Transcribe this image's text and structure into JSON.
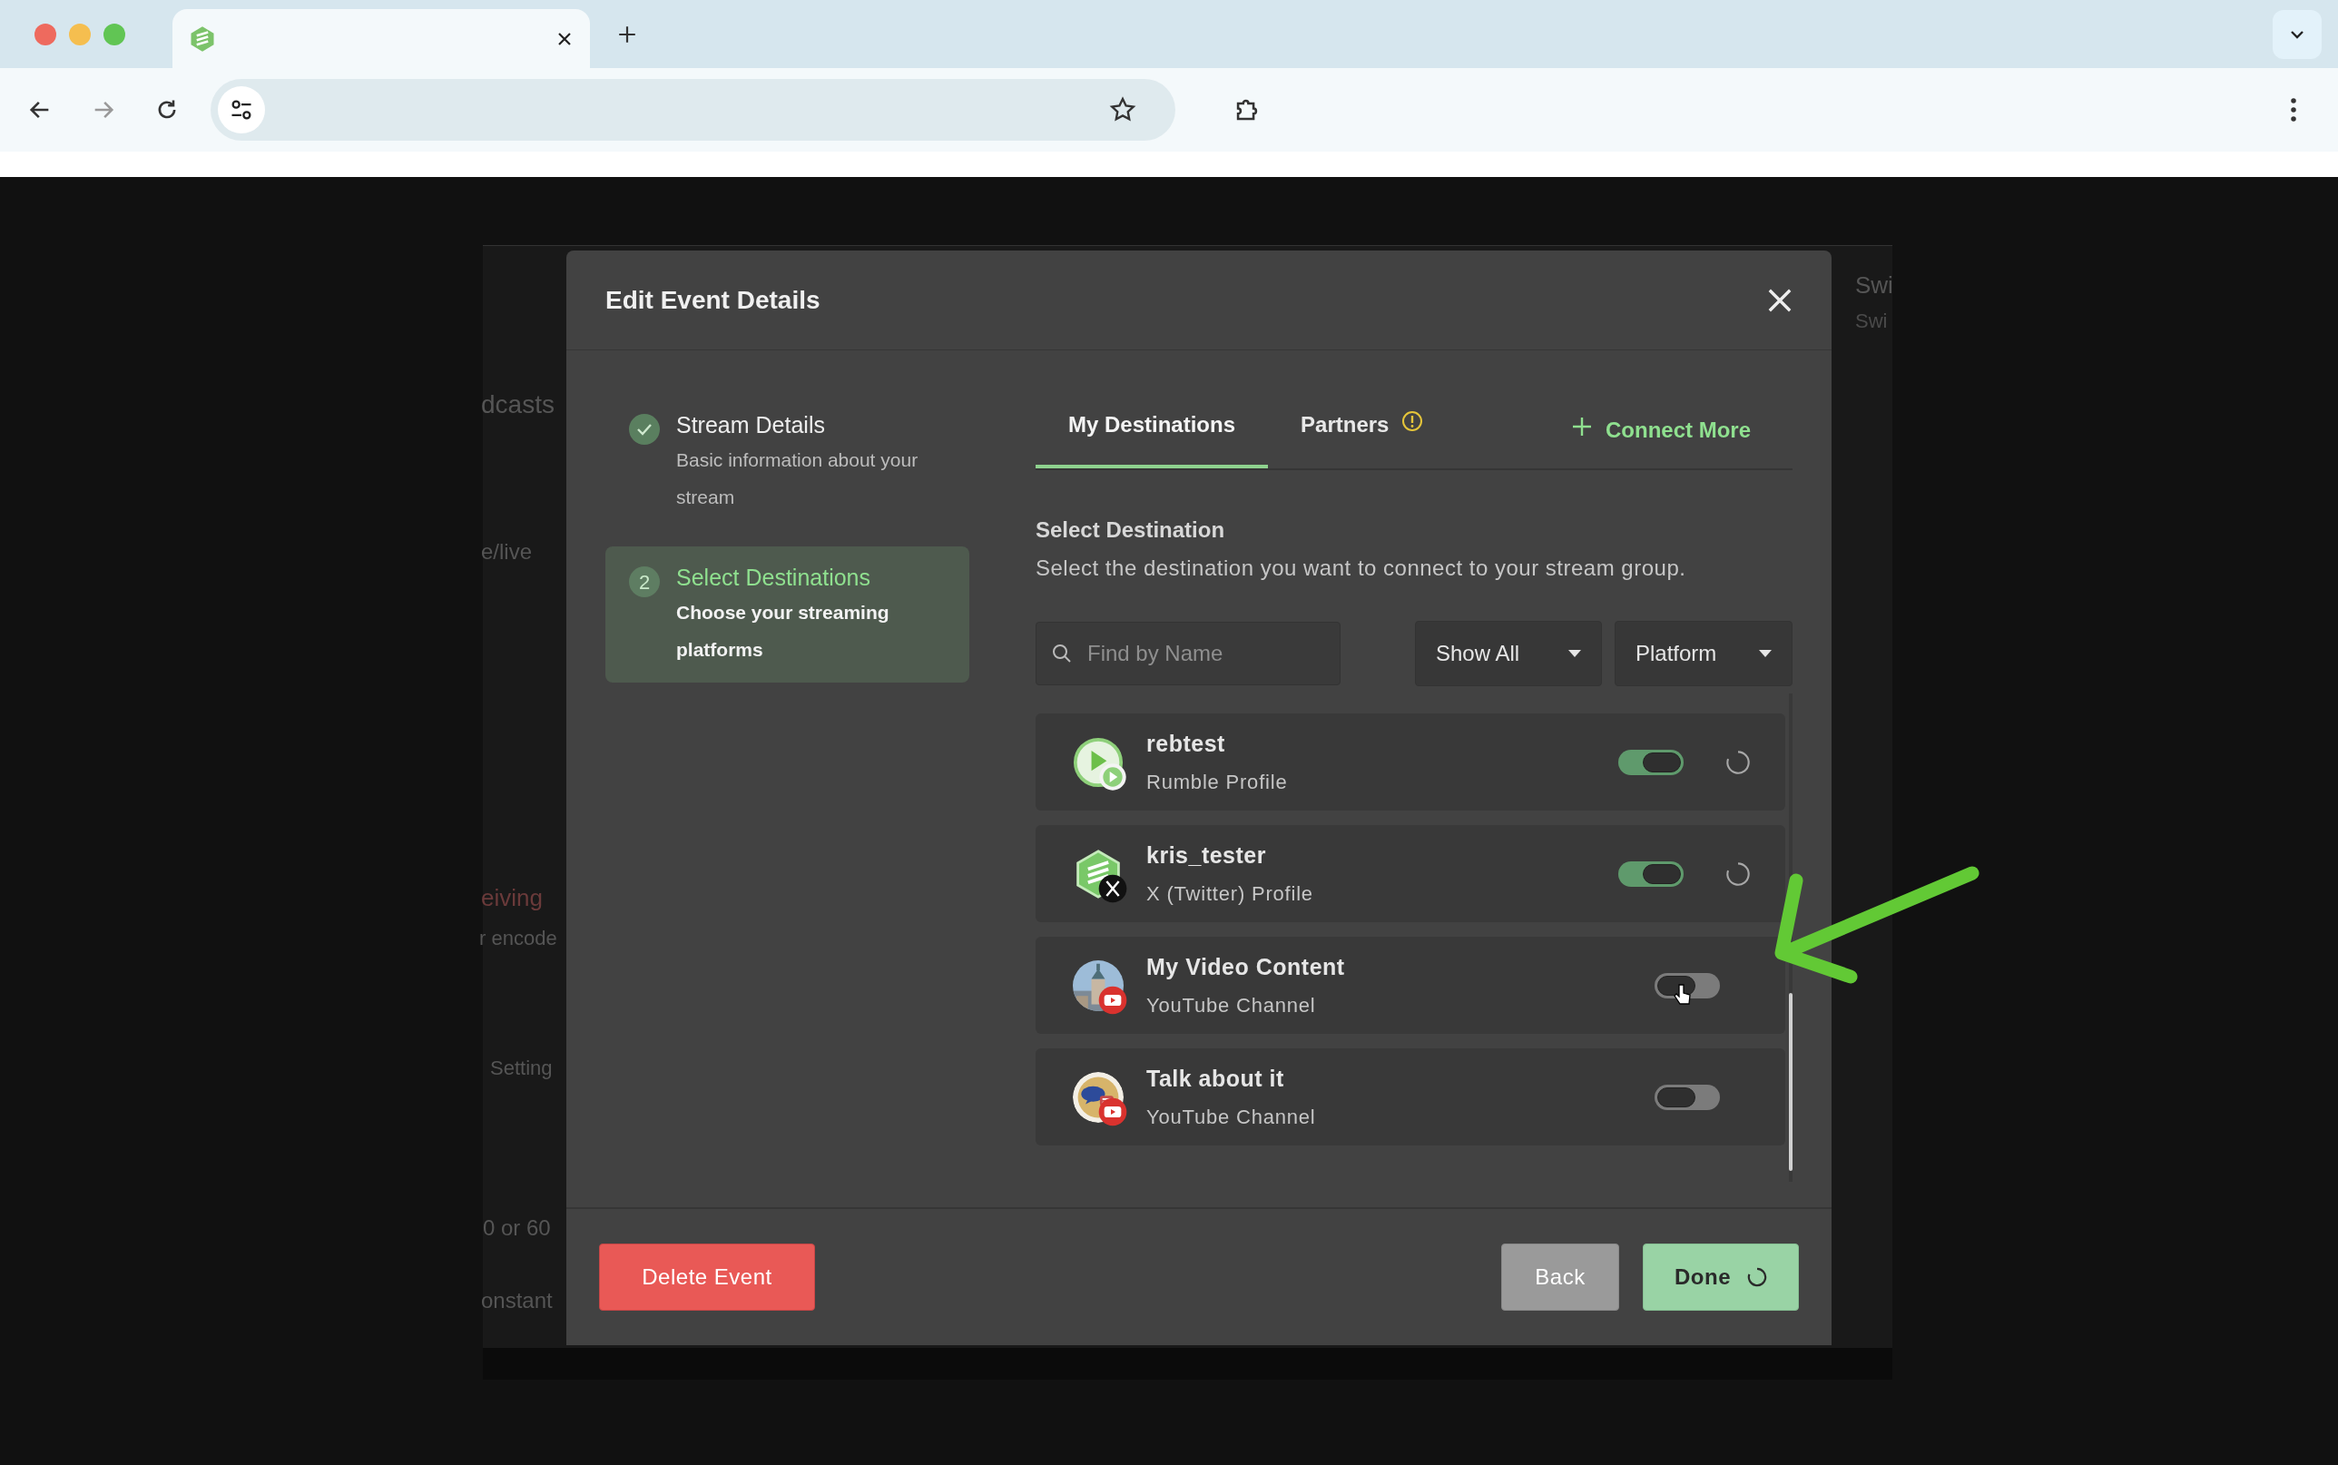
{
  "background_page": {
    "fragments": [
      "dcasts",
      "e/live",
      "eiving",
      "r encode",
      "Setting",
      "0 or 60",
      "onstant",
      "Swi",
      "Swi"
    ]
  },
  "modal": {
    "title": "Edit Event Details",
    "steps": [
      {
        "kind": "done",
        "title": "Stream Details",
        "description": "Basic information about your stream",
        "selected": false
      },
      {
        "kind": "current",
        "number": "2",
        "title": "Select Destinations",
        "description": "Choose your streaming platforms",
        "selected": true
      }
    ],
    "tabs": [
      {
        "label": "My Destinations",
        "selected": true,
        "alert": false
      },
      {
        "label": "Partners",
        "selected": false,
        "alert": true
      }
    ],
    "connect_more": "Connect More",
    "section_title": "Select Destination",
    "section_description": "Select the destination you want to connect to your stream group.",
    "search": {
      "placeholder": "Find by Name"
    },
    "filters": [
      "Show All",
      "Platform"
    ],
    "destinations": [
      {
        "name": "rebtest",
        "subtitle": "Rumble Profile",
        "kind": "rumble",
        "on": true,
        "loading": true
      },
      {
        "name": "kris_tester",
        "subtitle": "X (Twitter) Profile",
        "kind": "x",
        "on": true,
        "loading": true
      },
      {
        "name": "My Video Content",
        "subtitle": "YouTube Channel",
        "kind": "youtube",
        "on": false,
        "loading": false
      },
      {
        "name": "Talk about it",
        "subtitle": "YouTube Channel",
        "kind": "youtube",
        "on": false,
        "loading": false
      }
    ],
    "footer": {
      "delete": "Delete Event",
      "back": "Back",
      "done": "Done",
      "done_loading": true
    }
  }
}
